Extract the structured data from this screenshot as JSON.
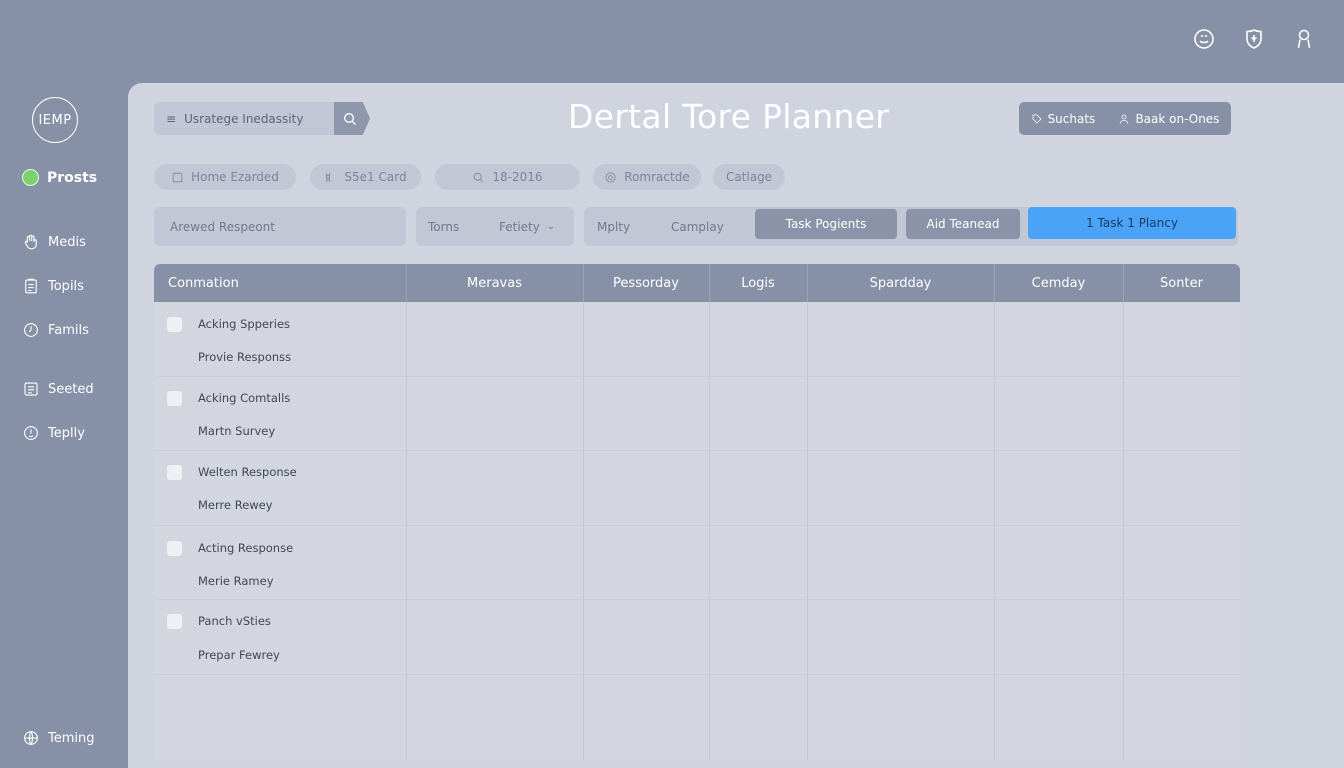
{
  "sidebar": {
    "logo": "IEMP",
    "items": [
      {
        "label": "Prosts",
        "icon": "green-dot-icon"
      },
      {
        "label": "Medis",
        "icon": "hand-icon"
      },
      {
        "label": "Topils",
        "icon": "clipboard-icon"
      },
      {
        "label": "Famils",
        "icon": "clock-icon"
      },
      {
        "label": "Seeted",
        "icon": "list-icon"
      },
      {
        "label": "Teplly",
        "icon": "reply-icon"
      }
    ],
    "footer": {
      "label": "Teming",
      "icon": "globe-icon"
    }
  },
  "top_icons": [
    "smile-icon",
    "shield-icon",
    "person-icon"
  ],
  "header": {
    "search_value": "Usratege Inedassity",
    "title": "Dertal Tore Planner",
    "actions": [
      "Suchats",
      "Baak on-Ones"
    ]
  },
  "chips": [
    "Home Ezarded",
    "S5e1 Card",
    "18-2016",
    "Romractde",
    "Catlage"
  ],
  "filter": {
    "field": "Arewed Respeont",
    "group1": [
      "Torns",
      "Fetiety"
    ],
    "group2": [
      "Mplty",
      "Camplay"
    ],
    "buttons": [
      "Task Pogients",
      "Aid Teanead"
    ],
    "primary": "1 Task 1 Plancy"
  },
  "table": {
    "columns": [
      "Conmation",
      "Meravas",
      "Pessorday",
      "Logis",
      "Spardday",
      "Cemday",
      "Sonter"
    ],
    "rows": [
      {
        "title": "Acking Spperies",
        "sub": "Provie Responss"
      },
      {
        "title": "Acking Comtalls",
        "sub": "Martn Survey"
      },
      {
        "title": "Welten Response",
        "sub": "Merre Rewey"
      },
      {
        "title": "Acting Response",
        "sub": "Merie Ramey"
      },
      {
        "title": "Panch vSties",
        "sub": "Prepar Fewrey"
      }
    ]
  },
  "colors": {
    "accent": "#4aa3f7",
    "chrome": "#8690a6",
    "panel": "#d0d4de",
    "active_dot": "#7bd16a"
  }
}
